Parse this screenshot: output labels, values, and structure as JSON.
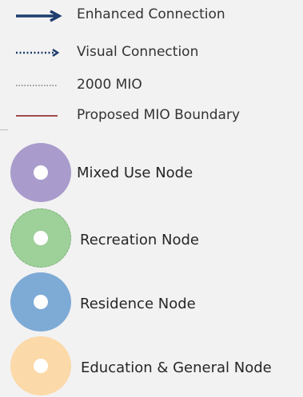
{
  "legend": {
    "lines": [
      {
        "label": "Enhanced Connection",
        "color": "#1f3c6e",
        "style": "solid-arrow"
      },
      {
        "label": "Visual Connection",
        "color": "#1f3c6e",
        "style": "dotted-arrow"
      },
      {
        "label": "2000 MIO",
        "color": "#7a7a7a",
        "style": "dotted"
      },
      {
        "label": "Proposed MIO Boundary",
        "color": "#a34a4a",
        "style": "solid"
      }
    ],
    "nodes": [
      {
        "label": "Mixed Use Node",
        "color": "#a99ccc"
      },
      {
        "label": "Recreation Node",
        "color": "#9ed09a"
      },
      {
        "label": "Residence Node",
        "color": "#7eaad6"
      },
      {
        "label": "Education & General Node",
        "color": "#fcd9a8"
      }
    ]
  }
}
